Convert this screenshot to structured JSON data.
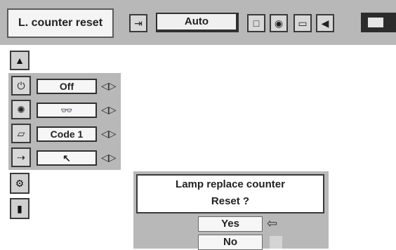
{
  "menu": {
    "title": "L. counter reset",
    "input_mode": "Auto"
  },
  "settings_panel": {
    "rows": [
      {
        "icon": "power-management-icon",
        "value": "Off"
      },
      {
        "icon": "lamp-icon",
        "value": "👓"
      },
      {
        "icon": "remote-code-icon",
        "value": "Code 1"
      },
      {
        "icon": "pointer-icon",
        "value": "↖"
      }
    ],
    "arrow_glyph": "◁▷"
  },
  "dialog": {
    "line1": "Lamp replace counter",
    "line2": "Reset ?",
    "yes_label": "Yes",
    "no_label": "No"
  }
}
